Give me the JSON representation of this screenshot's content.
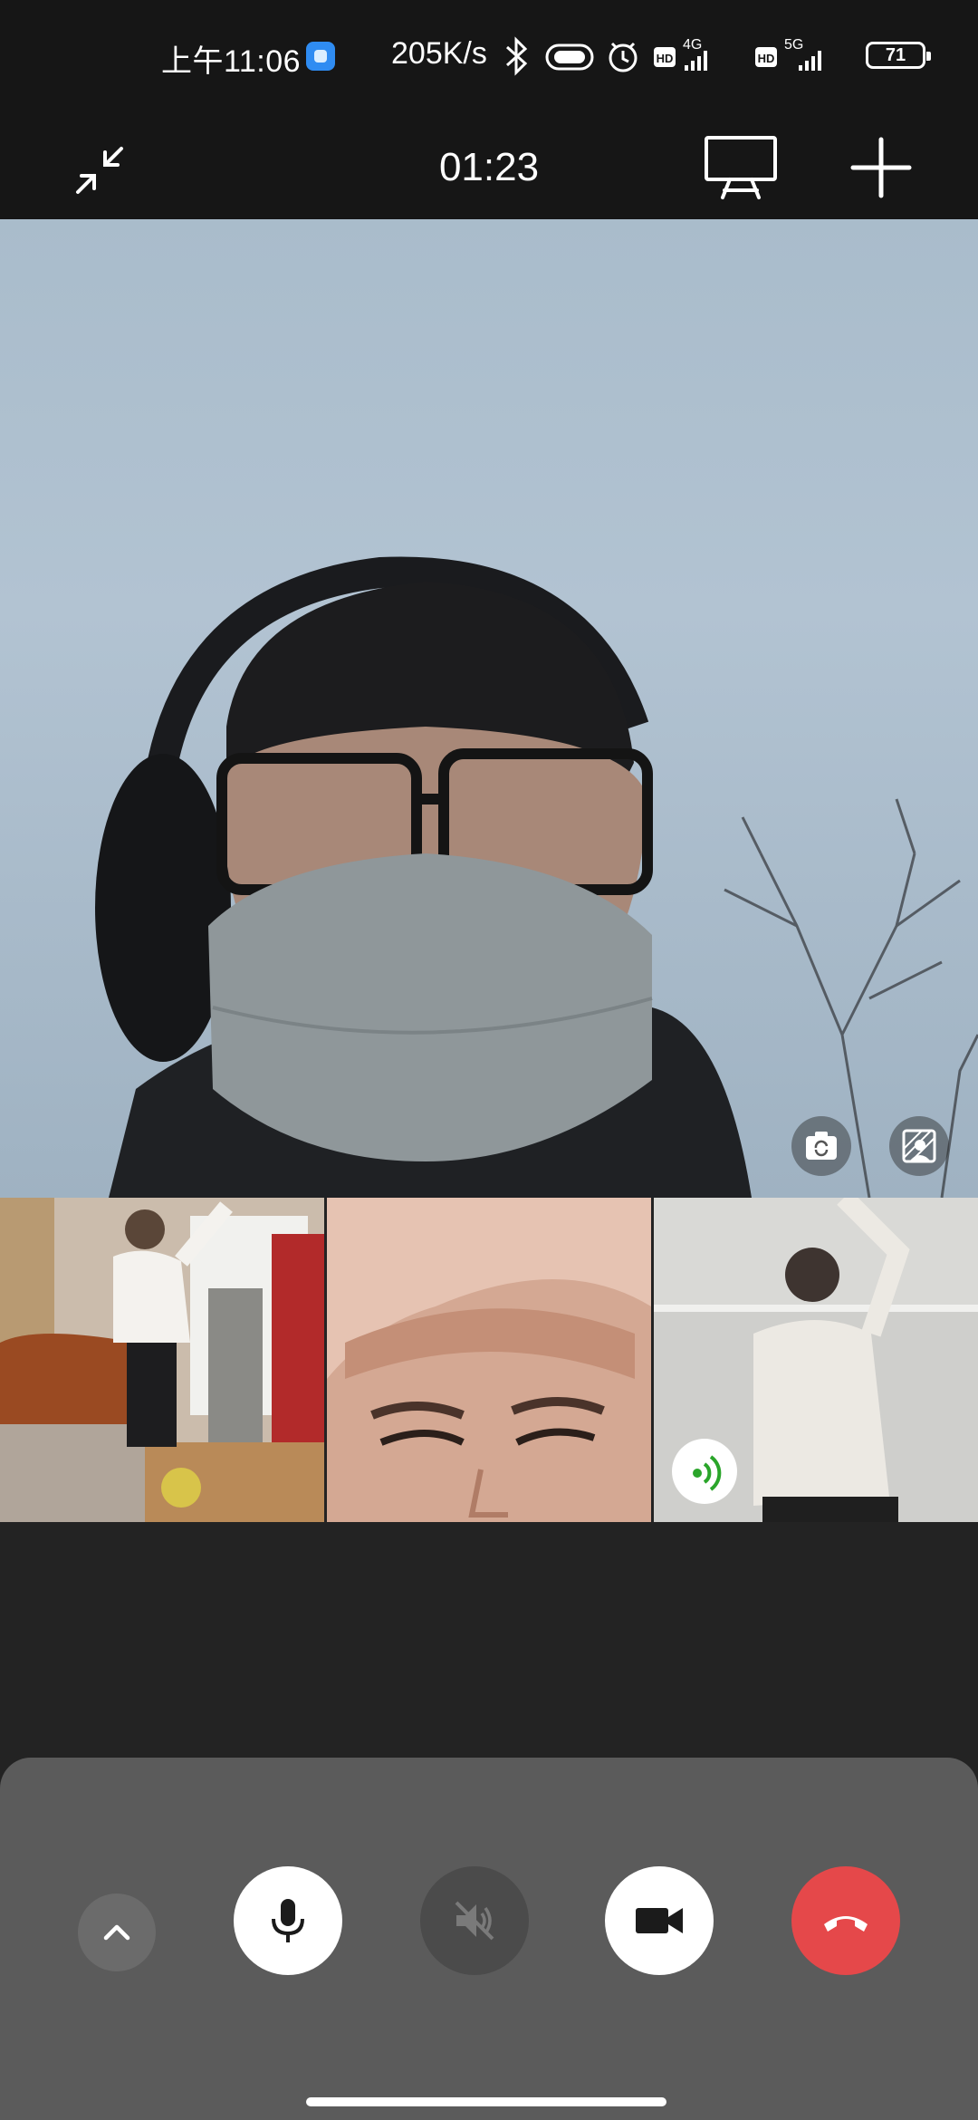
{
  "status_bar": {
    "time": "上午11:06",
    "speed": "205K/s",
    "network1": "4G",
    "network2": "5G",
    "hd": "HD",
    "battery": "71"
  },
  "call_bar": {
    "timer": "01:23"
  },
  "icons": {
    "minimize": "minimize-icon",
    "screen_share": "screen-share-icon",
    "add_participant": "add-icon",
    "switch_camera": "camera-switch-icon",
    "background": "background-blur-icon",
    "speaking": "speaking-indicator-icon",
    "expand": "chevron-up-icon",
    "mic": "microphone-icon",
    "speaker": "speaker-muted-icon",
    "camera": "video-camera-icon",
    "hangup": "hang-up-icon"
  },
  "colors": {
    "hangup": "#e5484a",
    "speaking": "#2aa52a",
    "panel": "#5b5b5b"
  }
}
